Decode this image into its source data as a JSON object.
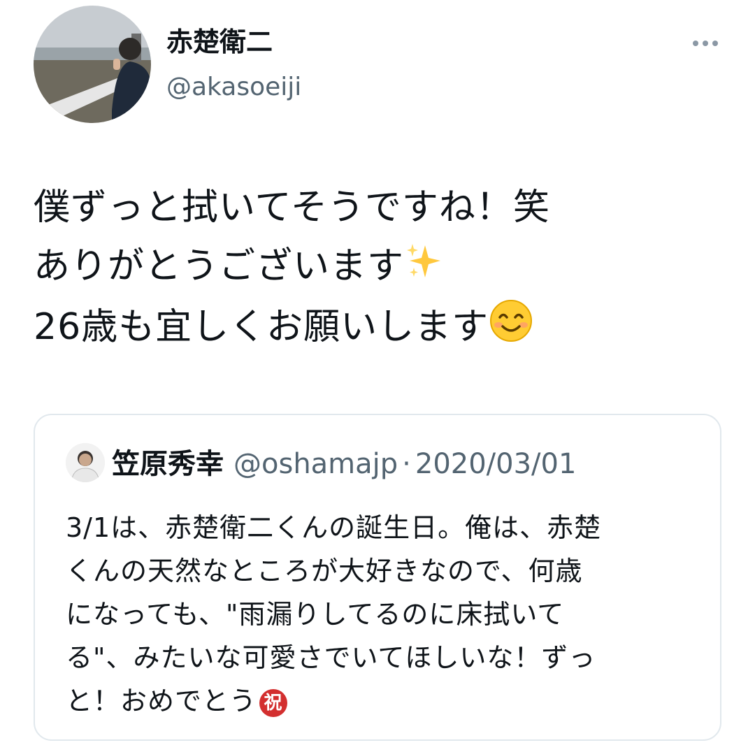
{
  "author": {
    "name": "赤楚衛二",
    "handle": "@akasoeiji",
    "avatar_icon": "profile-photo"
  },
  "more_icon": "more-dots-icon",
  "tweet": {
    "lines": [
      "僕ずっと拭いてそうですね！笑",
      "ありがとうございます",
      "26歳も宜しくお願いします"
    ],
    "emojis": [
      "sparkles-emoji",
      "smiling-face-emoji"
    ]
  },
  "quoted": {
    "name": "笠原秀幸",
    "handle": "@oshamajp",
    "separator": "·",
    "date": "2020/03/01",
    "lines": [
      "3/1は、赤楚衛二くんの誕生日。俺は、赤楚",
      "くんの天然なところが大好きなので、何歳",
      "になっても、\"雨漏りしてるのに床拭いて",
      "る\"、みたいな可愛さでいてほしいな！ずっ",
      "と！おめでとう"
    ],
    "badge": "祝"
  },
  "colors": {
    "text": "#0f1419",
    "secondary": "#536471",
    "border": "#e1e8ed",
    "badge": "#d32f2f"
  }
}
